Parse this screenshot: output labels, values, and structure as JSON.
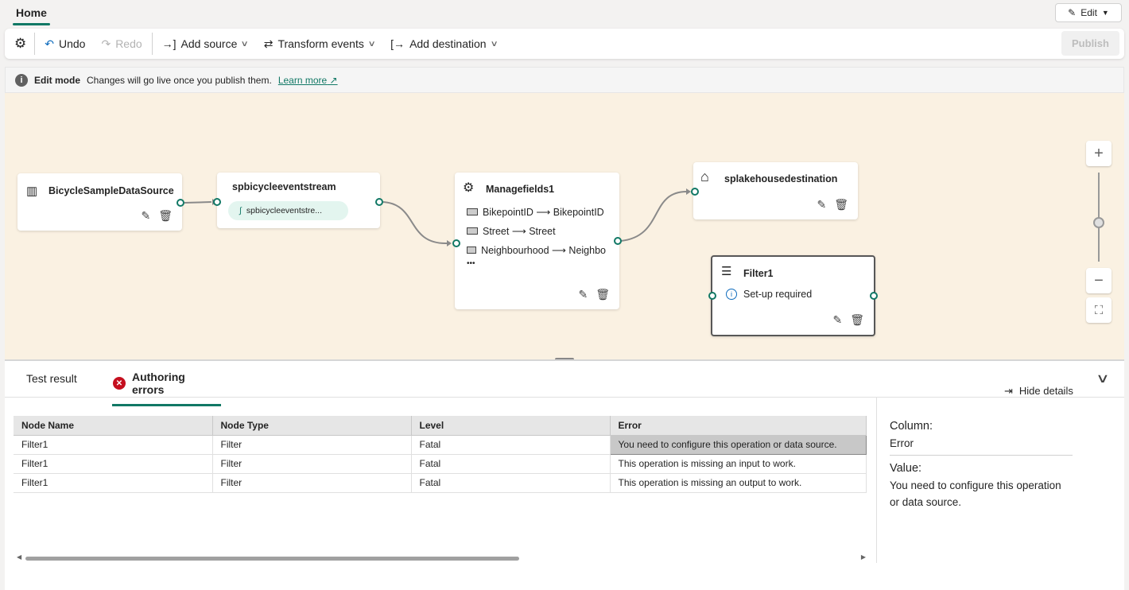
{
  "ribbon": {
    "tab": "Home",
    "edit_label": "Edit"
  },
  "toolbar": {
    "undo": "Undo",
    "redo": "Redo",
    "add_source": "Add source",
    "transform_events": "Transform events",
    "add_destination": "Add destination",
    "publish": "Publish"
  },
  "banner": {
    "title": "Edit mode",
    "message": "Changes will go live once you publish them.",
    "link": "Learn more"
  },
  "nodes": {
    "source": {
      "title": "BicycleSampleDataSource"
    },
    "stream": {
      "title": "spbicycleeventstream",
      "chip": "spbicycleeventstre..."
    },
    "manage": {
      "title": "Managefields1",
      "fields": [
        "BikepointID ⟶ BikepointID",
        "Street ⟶ Street",
        "Neighbourhood ⟶ Neighbo"
      ],
      "more": "•••"
    },
    "dest": {
      "title": "splakehousedestination"
    },
    "filter": {
      "title": "Filter1",
      "status": "Set-up required"
    }
  },
  "zoom_level": 0.5,
  "bottom": {
    "tabs": [
      "Test result",
      "Authoring errors"
    ],
    "hide_details": "Hide details",
    "columns": [
      "Node Name",
      "Node Type",
      "Level",
      "Error"
    ],
    "rows": [
      [
        "Filter1",
        "Filter",
        "Fatal",
        "You need to configure this operation or data source."
      ],
      [
        "Filter1",
        "Filter",
        "Fatal",
        "This operation is missing an input to work."
      ],
      [
        "Filter1",
        "Filter",
        "Fatal",
        "This operation is missing an output to work."
      ]
    ],
    "details": {
      "column_label": "Column:",
      "column_value": "Error",
      "value_label": "Value:",
      "value_text": "You need to configure this operation or data source."
    }
  },
  "colors": {
    "accent": "#117865",
    "canvas": "#faf1e2",
    "error": "#c50f1f"
  }
}
